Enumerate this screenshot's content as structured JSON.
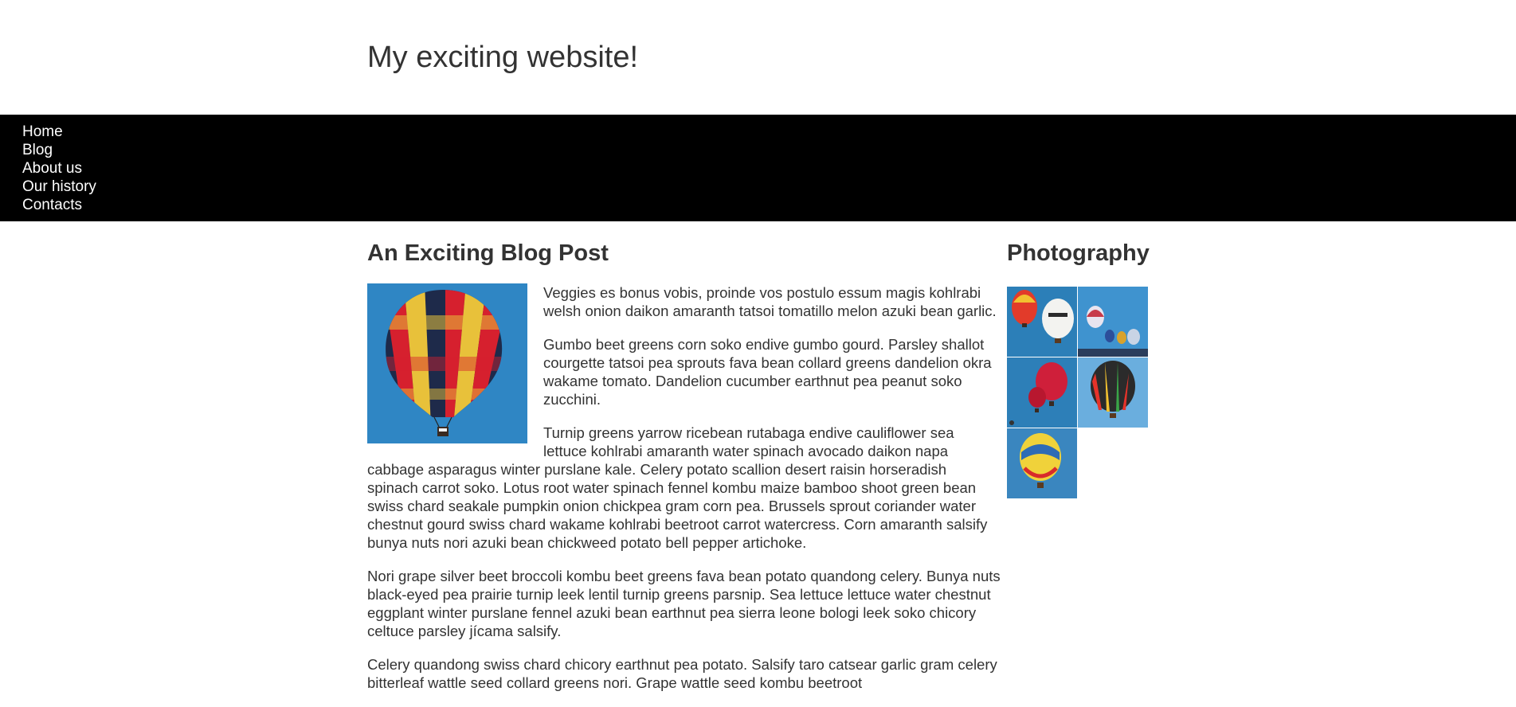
{
  "header": {
    "site_title": "My exciting website!"
  },
  "nav": {
    "items": [
      {
        "label": "Home"
      },
      {
        "label": "Blog"
      },
      {
        "label": "About us"
      },
      {
        "label": "Our history"
      },
      {
        "label": "Contacts"
      }
    ]
  },
  "post": {
    "title": "An Exciting Blog Post",
    "image_icon": "hot-air-balloon-photo",
    "paragraphs": [
      "Veggies es bonus vobis, proinde vos postulo essum magis kohlrabi welsh onion daikon amaranth tatsoi tomatillo melon azuki bean garlic.",
      "Gumbo beet greens corn soko endive gumbo gourd. Parsley shallot courgette tatsoi pea sprouts fava bean collard greens dandelion okra wakame tomato. Dandelion cucumber earthnut pea peanut soko zucchini.",
      "Turnip greens yarrow ricebean rutabaga endive cauliflower sea lettuce kohlrabi amaranth water spinach avocado daikon napa cabbage asparagus winter purslane kale. Celery potato scallion desert raisin horseradish spinach carrot soko. Lotus root water spinach fennel kombu maize bamboo shoot green bean swiss chard seakale pumpkin onion chickpea gram corn pea. Brussels sprout coriander water chestnut gourd swiss chard wakame kohlrabi beetroot carrot watercress. Corn amaranth salsify bunya nuts nori azuki bean chickweed potato bell pepper artichoke.",
      "Nori grape silver beet broccoli kombu beet greens fava bean potato quandong celery. Bunya nuts black-eyed pea prairie turnip leek lentil turnip greens parsnip. Sea lettuce lettuce water chestnut eggplant winter purslane fennel azuki bean earthnut pea sierra leone bologi leek soko chicory celtuce parsley jícama salsify.",
      "Celery quandong swiss chard chicory earthnut pea potato. Salsify taro catsear garlic gram celery bitterleaf wattle seed collard greens nori. Grape wattle seed kombu beetroot"
    ]
  },
  "sidebar": {
    "title": "Photography",
    "photos": [
      {
        "icon": "balloon-photo-1"
      },
      {
        "icon": "balloon-photo-2"
      },
      {
        "icon": "balloon-photo-3"
      },
      {
        "icon": "balloon-photo-4"
      },
      {
        "icon": "balloon-photo-5"
      }
    ]
  },
  "colors": {
    "nav_background": "#000000",
    "nav_text": "#ffffff",
    "body_text": "#333333",
    "sky_blue": "#3b8fc9"
  }
}
